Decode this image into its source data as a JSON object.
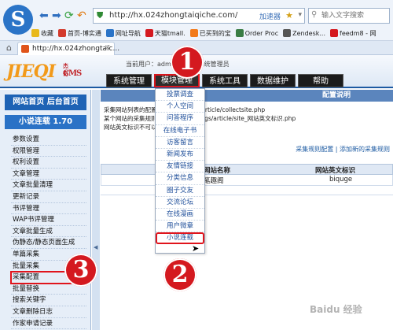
{
  "browser": {
    "url": "http://hx.024zhongtaiqiche.com/",
    "accelerate_label": "加速器",
    "search_placeholder": "输入文字搜索",
    "tab_title": "http://hx.024zhongtaic..."
  },
  "bookmarks": [
    {
      "label": "收藏",
      "icon": "star-icon",
      "color": "#e8b91c"
    },
    {
      "label": "首页-博实通",
      "icon": "page-icon",
      "color": "#d33a2c"
    },
    {
      "label": "网址导航",
      "icon": "globe-icon",
      "color": "#2b74c7"
    },
    {
      "label": "天猫tmall.",
      "icon": "tmall-icon",
      "color": "#d4191f"
    },
    {
      "label": "已买到的宝",
      "icon": "taobao-icon",
      "color": "#f27a1a"
    },
    {
      "label": "Order Proc",
      "icon": "refresh-icon",
      "color": "#3a7d44"
    },
    {
      "label": "Zendesk...",
      "icon": "gear-icon",
      "color": "#555555"
    },
    {
      "label": "feedm8 - 网",
      "icon": "feed-icon",
      "color": "#d4191f"
    }
  ],
  "cms": {
    "logo_main": "JIEQI",
    "logo_cms": "CMS",
    "logo_cn": "杰奇",
    "user_line": "当前用户：admin    身份：系统管理员",
    "nav": [
      "系统管理",
      "模块管理",
      "系统工具",
      "数据维护",
      "帮助"
    ]
  },
  "sidebar": {
    "top_links": "网站首页  后台首页",
    "section_title": "小说连载 1.70",
    "items": [
      "参数设置",
      "权限管理",
      "权利设置",
      "文章管理",
      "文章批量清理",
      "更新记录",
      "书评管理",
      "WAP书评管理",
      "文章批量生成",
      "伪静态/静态页面生成",
      "单篇采集",
      "批量采集",
      "采集配置",
      "批量替换",
      "搜索关键字",
      "文章删除日志",
      "作家申请记录"
    ],
    "highlighted_index": 12
  },
  "main": {
    "config_title": "配置说明",
    "config_lines": [
      "采集网站列表的配置文件是 /configs/article/collectsite.php",
      "某个网站的采集规则配置文件是 /configs/article/site_网站英文标识.php",
      "网站英文标识不可以重复"
    ],
    "actions": "采集规则配置 | 添加新的采集规则",
    "table_headers": [
      "网站名称",
      "网站英文标识"
    ],
    "table_rows": [
      {
        "name": "笔趣阁",
        "ident": "biquge"
      }
    ]
  },
  "dropdown": {
    "items": [
      "投票调查",
      "个人空间",
      "问答程序",
      "在线电子书",
      "访客留言",
      "新闻发布",
      "友情链接",
      "分类信息",
      "圈子交友",
      "交流论坛",
      "在线漫画",
      "用户微章",
      "小说连载"
    ],
    "highlighted_index": 12
  },
  "badges": [
    "1",
    "2",
    "3"
  ],
  "watermark": "Baidu 经验"
}
